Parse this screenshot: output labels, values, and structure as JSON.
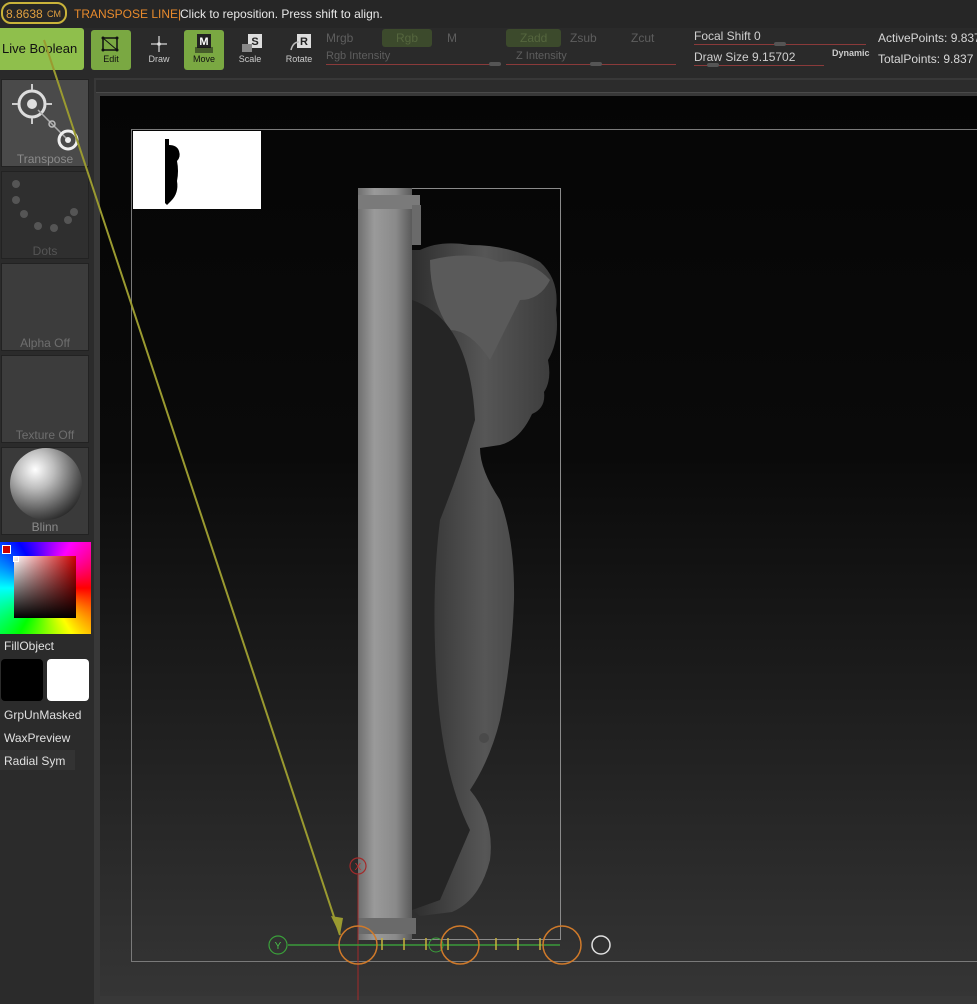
{
  "status": {
    "measurement": "8.8638",
    "unit": "CM",
    "transpose_label": "TRANSPOSE LINE|",
    "message": "Click to reposition. Press shift to align."
  },
  "toolbar": {
    "live_boolean": "Live Boolean",
    "edit": "Edit",
    "draw": "Draw",
    "move": "Move",
    "scale": "Scale",
    "rotate": "Rotate",
    "mrgb": "Mrgb",
    "rgb": "Rgb",
    "m": "M",
    "rgb_intensity": "Rgb Intensity",
    "zadd": "Zadd",
    "zsub": "Zsub",
    "zcut": "Zcut",
    "z_intensity": "Z Intensity",
    "focal_shift": "Focal Shift 0",
    "draw_size": "Draw Size 9.15702",
    "dynamic": "Dynamic",
    "active_points": "ActivePoints: 9.837",
    "total_points": "TotalPoints: 9.837"
  },
  "shelf": {
    "transpose": "Transpose",
    "dots": "Dots",
    "alpha": "Alpha Off",
    "texture": "Texture Off",
    "material": "Blinn",
    "fill_object": "FillObject",
    "grp_unmasked": "GrpUnMasked",
    "wax_preview": "WaxPreview",
    "radial_sym": "Radial Sym"
  },
  "gizmo": {
    "y_axis": "Y",
    "x_axis": "X"
  },
  "colors": {
    "accent_green": "#8fbf4c",
    "transpose_orange": "#e88a2c",
    "measure_yellow": "#c9b33a",
    "line_yellow": "#9a9a30"
  }
}
